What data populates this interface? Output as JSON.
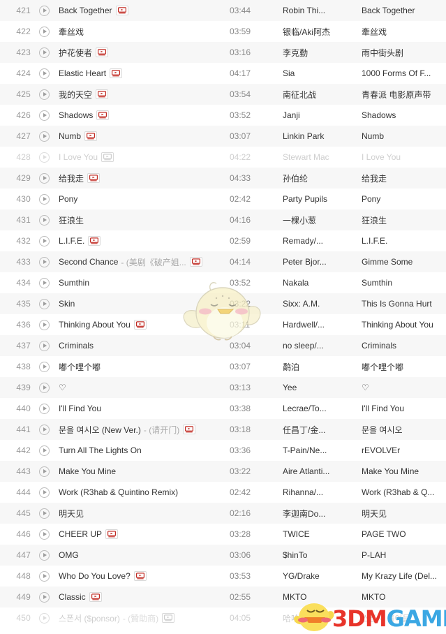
{
  "app": {
    "view": "music-playlist-table",
    "colors": {
      "row_bg": "#ffffff",
      "row_alt_bg": "#f7f7f7",
      "index_text": "#9a9a9a",
      "title_text": "#333333",
      "subtitle_text": "#aaaaaa",
      "time_text": "#888888",
      "disabled_text": "#cfcfcf",
      "mv_red": "#c02a22",
      "logo_red": "#e8342a",
      "logo_blue": "#3ba7e3"
    }
  },
  "watermarks": {
    "chick": {
      "name": "chick-watermark"
    },
    "logo": {
      "name": "3dmgame-logo-watermark",
      "text_red": "3DM",
      "text_blue": "GAME",
      "dot": "·"
    }
  },
  "icons": {
    "play": "play-circle-icon",
    "mv": "mv-video-icon"
  },
  "rows": [
    {
      "index": "421",
      "title": "Back Together",
      "subtitle": "",
      "mv": true,
      "time": "03:44",
      "artist": "Robin Thi...",
      "album": "Back Together",
      "disabled": false
    },
    {
      "index": "422",
      "title": "牽丝戏",
      "subtitle": "",
      "mv": false,
      "time": "03:59",
      "artist": "银临/Aki阿杰",
      "album": "牽丝戏",
      "disabled": false
    },
    {
      "index": "423",
      "title": "护花使者",
      "subtitle": "",
      "mv": true,
      "time": "03:16",
      "artist": "李克勤",
      "album": "雨中街头剧",
      "disabled": false
    },
    {
      "index": "424",
      "title": "Elastic Heart",
      "subtitle": "",
      "mv": true,
      "time": "04:17",
      "artist": "Sia",
      "album": "1000 Forms Of F...",
      "disabled": false
    },
    {
      "index": "425",
      "title": "我的天空",
      "subtitle": "",
      "mv": true,
      "time": "03:54",
      "artist": "南征北战",
      "album": "青春派 电影原声带",
      "disabled": false
    },
    {
      "index": "426",
      "title": "Shadows",
      "subtitle": "",
      "mv": true,
      "time": "03:52",
      "artist": "Janji",
      "album": "Shadows",
      "disabled": false
    },
    {
      "index": "427",
      "title": "Numb",
      "subtitle": "",
      "mv": true,
      "time": "03:07",
      "artist": "Linkin Park",
      "album": "Numb",
      "disabled": false
    },
    {
      "index": "428",
      "title": "I Love You",
      "subtitle": "",
      "mv": true,
      "time": "04:22",
      "artist": "Stewart Mac",
      "album": "I Love You",
      "disabled": true
    },
    {
      "index": "429",
      "title": "给我走",
      "subtitle": "",
      "mv": true,
      "time": "04:33",
      "artist": "孙伯纶",
      "album": "给我走",
      "disabled": false
    },
    {
      "index": "430",
      "title": "Pony",
      "subtitle": "",
      "mv": false,
      "time": "02:42",
      "artist": "Party Pupils",
      "album": "Pony",
      "disabled": false
    },
    {
      "index": "431",
      "title": "狂浪生",
      "subtitle": "",
      "mv": false,
      "time": "04:16",
      "artist": "一棵小葱",
      "album": "狂浪生",
      "disabled": false
    },
    {
      "index": "432",
      "title": "L.I.F.E.",
      "subtitle": "",
      "mv": true,
      "time": "02:59",
      "artist": "Remady/...",
      "album": "L.I.F.E.",
      "disabled": false
    },
    {
      "index": "433",
      "title": "Second Chance",
      "subtitle": "- (美剧《破产姐...",
      "mv": true,
      "time": "04:14",
      "artist": "Peter Bjor...",
      "album": "Gimme Some",
      "disabled": false
    },
    {
      "index": "434",
      "title": "Sumthin",
      "subtitle": "",
      "mv": false,
      "time": "03:52",
      "artist": "Nakala",
      "album": "Sumthin",
      "disabled": false
    },
    {
      "index": "435",
      "title": "Skin",
      "subtitle": "",
      "mv": false,
      "time": "03:22",
      "artist": "Sixx: A.M.",
      "album": "This Is Gonna Hurt",
      "disabled": false
    },
    {
      "index": "436",
      "title": "Thinking About You",
      "subtitle": "",
      "mv": true,
      "time": "03:11",
      "artist": "Hardwell/...",
      "album": "Thinking About You",
      "disabled": false
    },
    {
      "index": "437",
      "title": "Criminals",
      "subtitle": "",
      "mv": false,
      "time": "03:04",
      "artist": "no sleep/...",
      "album": "Criminals",
      "disabled": false
    },
    {
      "index": "438",
      "title": "嘟个哩个嘟",
      "subtitle": "",
      "mv": false,
      "time": "03:07",
      "artist": "鹬泊",
      "album": "嘟个哩个嘟",
      "disabled": false
    },
    {
      "index": "439",
      "title": "♡",
      "subtitle": "",
      "mv": false,
      "time": "03:13",
      "artist": "Yee",
      "album": "♡",
      "disabled": false
    },
    {
      "index": "440",
      "title": "I'll Find You",
      "subtitle": "",
      "mv": false,
      "time": "03:38",
      "artist": "Lecrae/To...",
      "album": "I'll Find You",
      "disabled": false
    },
    {
      "index": "441",
      "title": "문을 여시오 (New Ver.)",
      "subtitle": "- (请开门)",
      "mv": true,
      "time": "03:18",
      "artist": "任昌丁/金...",
      "album": "문을 여시오",
      "disabled": false
    },
    {
      "index": "442",
      "title": "Turn All The Lights On",
      "subtitle": "",
      "mv": false,
      "time": "03:36",
      "artist": "T-Pain/Ne...",
      "album": "rEVOLVEr",
      "disabled": false
    },
    {
      "index": "443",
      "title": "Make You Mine",
      "subtitle": "",
      "mv": false,
      "time": "03:22",
      "artist": "Aire Atlanti...",
      "album": "Make You Mine",
      "disabled": false
    },
    {
      "index": "444",
      "title": "Work (R3hab & Quintino Remix)",
      "subtitle": "",
      "mv": false,
      "time": "02:42",
      "artist": "Rihanna/...",
      "album": "Work (R3hab & Q...",
      "disabled": false
    },
    {
      "index": "445",
      "title": "明天见",
      "subtitle": "",
      "mv": false,
      "time": "02:16",
      "artist": "李迦南Do...",
      "album": "明天见",
      "disabled": false
    },
    {
      "index": "446",
      "title": "CHEER UP",
      "subtitle": "",
      "mv": true,
      "time": "03:28",
      "artist": "TWICE",
      "album": "PAGE TWO",
      "disabled": false
    },
    {
      "index": "447",
      "title": "OMG",
      "subtitle": "",
      "mv": false,
      "time": "03:06",
      "artist": "$hinTo",
      "album": "P-LAH",
      "disabled": false
    },
    {
      "index": "448",
      "title": "Who Do You Love?",
      "subtitle": "",
      "mv": true,
      "time": "03:53",
      "artist": "YG/Drake",
      "album": "My Krazy Life (Del...",
      "disabled": false
    },
    {
      "index": "449",
      "title": "Classic",
      "subtitle": "",
      "mv": true,
      "time": "02:55",
      "artist": "MKTO",
      "album": "MKTO",
      "disabled": false
    },
    {
      "index": "450",
      "title": "스폰서 ($ponsor)",
      "subtitle": "- (贊助商)",
      "mv": true,
      "time": "04:05",
      "artist": "哈哈Zion.T",
      "album": "스폰서 올여들",
      "disabled": true
    }
  ]
}
